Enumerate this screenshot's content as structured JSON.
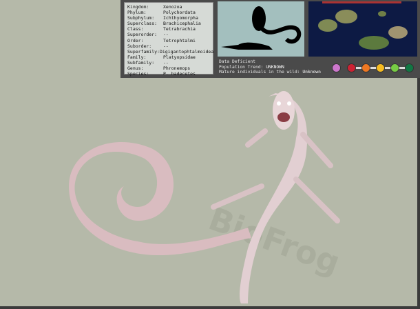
{
  "taxonomy": [
    {
      "k": "Kingdom:",
      "v": "Xenozoa"
    },
    {
      "k": "Phylum:",
      "v": "Polychordata"
    },
    {
      "k": "Subphylum:",
      "v": "Ichthyomorpha"
    },
    {
      "k": "Superclass:",
      "v": "Brachicephalia"
    },
    {
      "k": "Class:",
      "v": "Tetrabrachia"
    },
    {
      "k": "Superorder:",
      "v": "--"
    },
    {
      "k": "Order:",
      "v": "Tetrophtalmi"
    },
    {
      "k": "Suborder:",
      "v": "--"
    },
    {
      "k": "Superfamily:",
      "v": "Digigantophtalmoidea"
    },
    {
      "k": "Family:",
      "v": "Platyopsidae"
    },
    {
      "k": "Subfamily:",
      "v": "--"
    },
    {
      "k": "Genus:",
      "v": "Phronemops"
    },
    {
      "k": "Species:",
      "v": "P. hadecetes"
    }
  ],
  "status": {
    "category": "Data Deficient",
    "trend_label": "Population Trend:",
    "trend": "UNKNOWN",
    "mature_label": "Mature individuals in the wild:",
    "mature": "Unknown"
  },
  "conservation_colors": [
    "#cc77cc",
    "#cc2233",
    "#ee7722",
    "#f5bb22",
    "#77cc44",
    "#117744"
  ],
  "watermark": "BioFrog"
}
